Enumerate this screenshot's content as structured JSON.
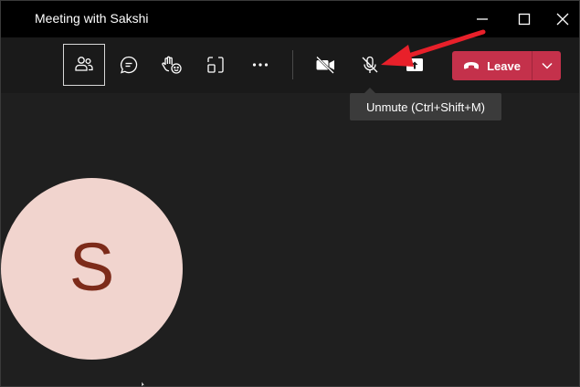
{
  "window": {
    "title": "Meeting with Sakshi"
  },
  "toolbar": {
    "items": [
      {
        "name": "participants",
        "icon": "people-icon",
        "active": true
      },
      {
        "name": "chat",
        "icon": "chat-icon",
        "active": false
      },
      {
        "name": "reactions",
        "icon": "raise-hand-icon",
        "active": false
      },
      {
        "name": "rooms",
        "icon": "rooms-icon",
        "active": false
      },
      {
        "name": "more",
        "icon": "more-icon",
        "active": false
      },
      {
        "name": "camera",
        "icon": "camera-off-icon",
        "active": false
      },
      {
        "name": "microphone",
        "icon": "mic-off-icon",
        "active": false
      },
      {
        "name": "share",
        "icon": "share-icon",
        "active": false
      }
    ],
    "leave_label": "Leave"
  },
  "tooltip": {
    "text": "Unmute (Ctrl+Shift+M)"
  },
  "participant": {
    "initial": "S"
  },
  "colors": {
    "leave": "#c4314b",
    "avatar_bg": "#f1d4ce",
    "avatar_text": "#7d2b1a",
    "annotation_arrow": "#e8202a"
  }
}
